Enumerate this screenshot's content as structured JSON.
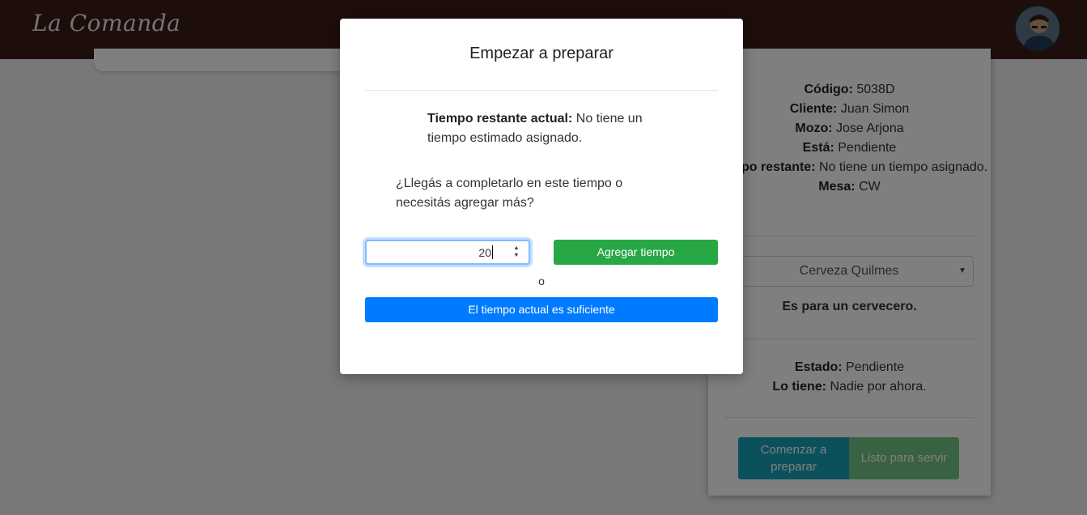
{
  "navbar": {
    "brand": "La Comanda"
  },
  "order_card": {
    "codigo_label": "Código:",
    "codigo_value": "5038D",
    "cliente_label": "Cliente:",
    "cliente_value": "Juan Simon",
    "mozo_label": "Mozo:",
    "mozo_value": "Jose Arjona",
    "esta_label": "Está:",
    "esta_value": "Pendiente",
    "tiempo_label": "Tiempo restante:",
    "tiempo_value": "No tiene un tiempo asignado.",
    "mesa_label": "Mesa:",
    "mesa_value": "CW",
    "product_selected": "Cerveza Quilmes",
    "for_who": "Es para un cervecero.",
    "estado_label": "Estado:",
    "estado_value": "Pendiente",
    "lo_tiene_label": "Lo tiene:",
    "lo_tiene_value": "Nadie por ahora.",
    "start_button": "Comenzar a preparar",
    "ready_button": "Listo para servir"
  },
  "modal": {
    "title": "Empezar a preparar",
    "time_label": "Tiempo restante actual:",
    "time_value": "No tiene un tiempo estimado asignado.",
    "question": "¿Llegás a completarlo en este tiempo o necesitás agregar más?",
    "input_value": "20",
    "add_button": "Agregar tiempo",
    "or_text": "o",
    "enough_button": "El tiempo actual es suficiente"
  },
  "colors": {
    "navbar_bg": "#3a1c16",
    "success": "#28a745",
    "primary": "#007bff",
    "info": "#17a2b8"
  }
}
